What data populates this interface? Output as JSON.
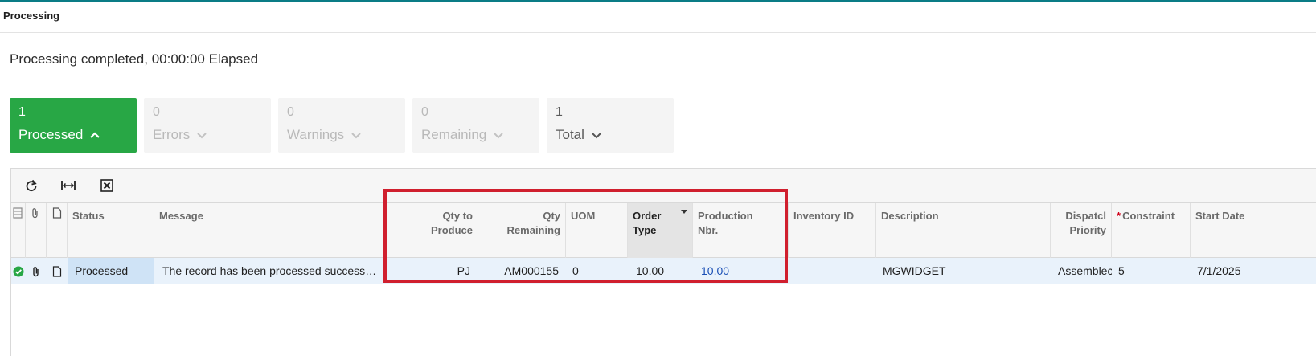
{
  "window": {
    "title": "Processing"
  },
  "status_text": "Processing completed, 00:00:00 Elapsed",
  "colors": {
    "accent_green": "#28a745",
    "highlight_red": "#d01f2e",
    "link_blue": "#1a4fb5",
    "top_line": "#0a7c86"
  },
  "tiles": [
    {
      "count": "1",
      "label": "Processed",
      "state": "active",
      "chevron": "up"
    },
    {
      "count": "0",
      "label": "Errors",
      "state": "disabled",
      "chevron": "down"
    },
    {
      "count": "0",
      "label": "Warnings",
      "state": "disabled",
      "chevron": "down"
    },
    {
      "count": "0",
      "label": "Remaining",
      "state": "disabled",
      "chevron": "down"
    },
    {
      "count": "1",
      "label": "Total",
      "state": "normal",
      "chevron": "down"
    }
  ],
  "toolbar": {
    "buttons": [
      {
        "icon": "refresh-icon"
      },
      {
        "icon": "fit-columns-icon"
      },
      {
        "icon": "excel-export-icon"
      }
    ]
  },
  "columns": {
    "status": "Status",
    "message": "Message",
    "qty_to_produce_1": "Qty to",
    "qty_to_produce_2": "Produce",
    "qty_remaining_1": "Qty",
    "qty_remaining_2": "Remaining",
    "uom": "UOM",
    "order_type_1": "Order",
    "order_type_2": "Type",
    "production_nbr_1": "Production",
    "production_nbr_2": "Nbr.",
    "inventory_id": "Inventory ID",
    "description": "Description",
    "dispatch_priority_1": "Dispatcl",
    "dispatch_priority_2": "Priority",
    "constraint_req": "*",
    "constraint": "Constraint",
    "start_date": "Start Date"
  },
  "rows": [
    {
      "status": "Processed",
      "message": "The record has been processed successf…",
      "qty_to_produce": "PJ",
      "qty_remaining": "AM000155",
      "uom": "0",
      "order_type": "10.00",
      "production_nbr": "10.00",
      "inventory_id": "",
      "description": "MGWIDGET",
      "dispatch_priority": "Assemblec",
      "constraint": "5",
      "start_date": "7/1/2025"
    }
  ]
}
